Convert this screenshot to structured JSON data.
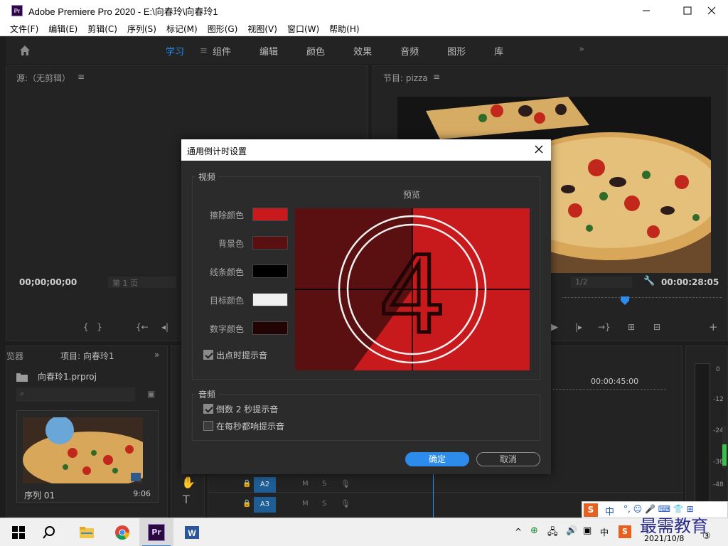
{
  "app": {
    "title": "Adobe Premiere Pro 2020 - E:\\向春玲\\向春玲1",
    "logo_text": "Pr"
  },
  "menu": [
    "文件(F)",
    "编辑(E)",
    "剪辑(C)",
    "序列(S)",
    "标记(M)",
    "图形(G)",
    "视图(V)",
    "窗口(W)",
    "帮助(H)"
  ],
  "workspaces": {
    "tabs": [
      "学习",
      "组件",
      "编辑",
      "颜色",
      "效果",
      "音频",
      "图形",
      "库"
    ],
    "active": "学习",
    "more": "»"
  },
  "source_panel": {
    "title": "源:（无剪辑）",
    "timecode": "00;00;00;00",
    "pager": "第 1 页"
  },
  "program_panel": {
    "title": "节目: pizza",
    "timecode": "00:00:28:05",
    "zoom": "1/2"
  },
  "project_panel": {
    "tab_browser": "览器",
    "tab_project": "项目: 向春玲1",
    "file_name": "向春玲1.prproj",
    "clip_name": "序列 01",
    "clip_duration": "9:06"
  },
  "timeline": {
    "time": "00:00:45:00",
    "tracks": [
      "A2",
      "A3"
    ],
    "track_buttons": [
      "M",
      "S"
    ],
    "meter_labels": [
      "0",
      "-12",
      "-24",
      "-36",
      "-48"
    ]
  },
  "dialog": {
    "title": "通用倒计时设置",
    "video_group": "视频",
    "preview_label": "预览",
    "rows": [
      {
        "label": "擦除颜色",
        "color": "#c8191d"
      },
      {
        "label": "背景色",
        "color": "#5a0f10"
      },
      {
        "label": "线条颜色",
        "color": "#000000"
      },
      {
        "label": "目标颜色",
        "color": "#f0f0f0"
      },
      {
        "label": "数字颜色",
        "color": "#230405"
      }
    ],
    "preview_digit": "4",
    "cue_out": {
      "label": "出点时提示音",
      "checked": true
    },
    "audio_group": "音频",
    "cue_2sec": {
      "label": "倒数 2 秒提示音",
      "checked": true
    },
    "cue_each": {
      "label": "在每秒都响提示音",
      "checked": false
    },
    "ok": "确定",
    "cancel": "取消"
  },
  "taskbar": {
    "date": "2021/10/8",
    "ime": "中",
    "tray_ime": "中",
    "watermark": "最需教育"
  },
  "colors": {
    "accent": "#2d8ceb",
    "track": "#1d5e96"
  }
}
